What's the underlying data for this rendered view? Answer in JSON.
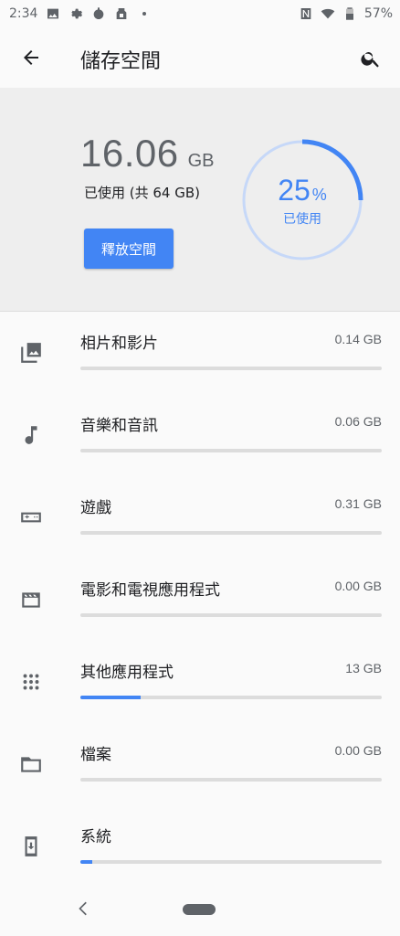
{
  "status_bar": {
    "time": "2:34",
    "battery": "57%",
    "icons_left": [
      "image-icon",
      "gear-icon",
      "bug-icon",
      "app-icon",
      "dot-icon"
    ],
    "icons_right": [
      "nfc-icon",
      "wifi-icon",
      "battery-icon"
    ]
  },
  "top_bar": {
    "title": "儲存空間",
    "back_icon": "back-arrow-icon",
    "search_icon": "search-icon"
  },
  "summary": {
    "used_number": "16.06",
    "used_unit": "GB",
    "used_caption": "已使用 (共 64 GB)",
    "free_button": "釋放空間",
    "percent_value": "25",
    "percent_sign": "%",
    "percent_label": "已使用",
    "percent_fraction": 0.25,
    "accent_color": "#4285f4"
  },
  "categories": [
    {
      "label": "相片和影片",
      "size": "0.14 GB",
      "icon": "photo-library-icon",
      "fraction": 0.0
    },
    {
      "label": "音樂和音訊",
      "size": "0.06 GB",
      "icon": "music-note-icon",
      "fraction": 0.0
    },
    {
      "label": "遊戲",
      "size": "0.31 GB",
      "icon": "gamepad-icon",
      "fraction": 0.0
    },
    {
      "label": "電影和電視應用程式",
      "size": "0.00 GB",
      "icon": "movie-icon",
      "fraction": 0.0
    },
    {
      "label": "其他應用程式",
      "size": "13 GB",
      "icon": "apps-grid-icon",
      "fraction": 0.2
    },
    {
      "label": "檔案",
      "size": "0.00 GB",
      "icon": "folder-icon",
      "fraction": 0.0
    },
    {
      "label": "系統",
      "size": "",
      "icon": "system-update-icon",
      "fraction": 0.04
    }
  ],
  "nav_bar": {
    "back_icon": "nav-back-icon",
    "home_icon": "home-pill-icon"
  }
}
